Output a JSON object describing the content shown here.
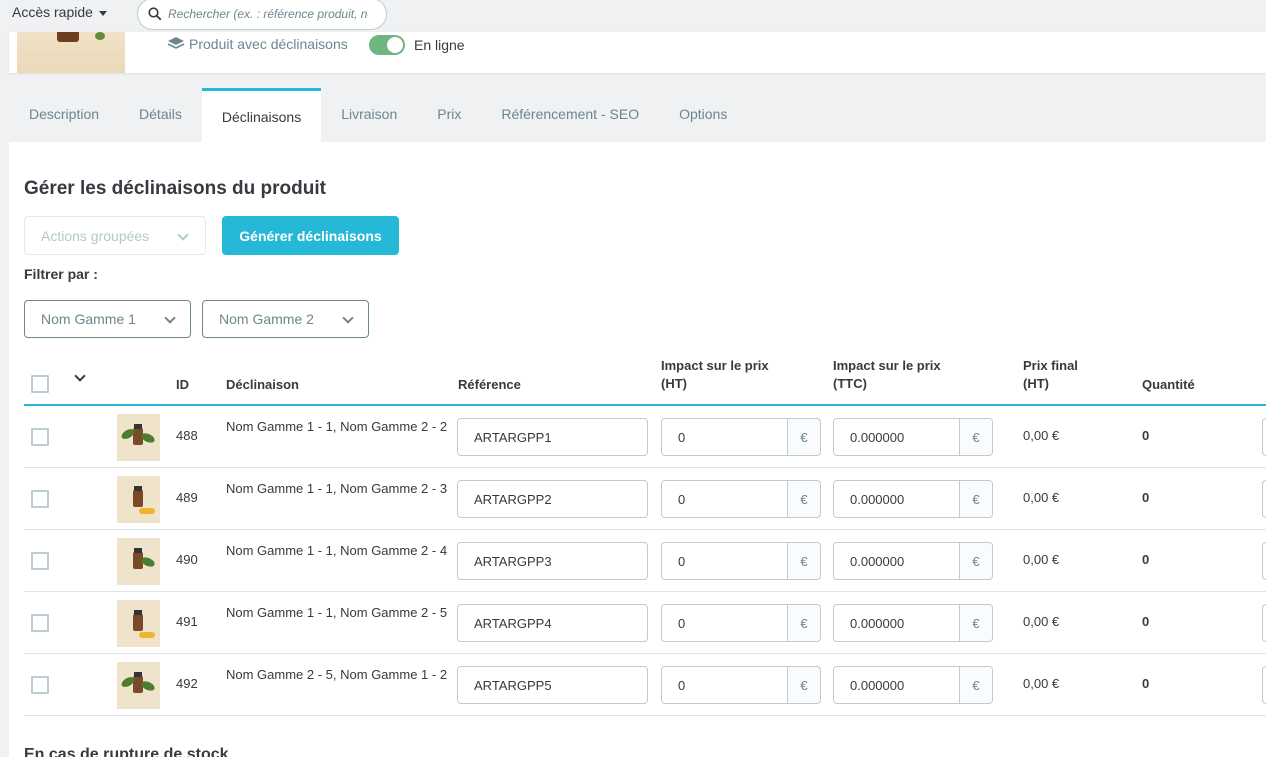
{
  "header": {
    "quick_access": "Accès rapide",
    "search_placeholder": "Rechercher (ex. : référence produit, no",
    "product_type": "Produit avec déclinaisons",
    "online_label": "En ligne",
    "online": true
  },
  "tabs": [
    {
      "label": "Description"
    },
    {
      "label": "Détails"
    },
    {
      "label": "Déclinaisons",
      "active": true
    },
    {
      "label": "Livraison"
    },
    {
      "label": "Prix"
    },
    {
      "label": "Référencement - SEO"
    },
    {
      "label": "Options"
    }
  ],
  "panel": {
    "title": "Gérer les déclinaisons du produit",
    "bulk_actions": "Actions groupées",
    "generate": "Générer déclinaisons",
    "filter_label": "Filtrer par :",
    "filters": [
      "Nom Gamme 1",
      "Nom Gamme 2"
    ],
    "footer_title": "En cas de rupture de stock"
  },
  "table": {
    "columns": {
      "id": "ID",
      "declinaison": "Déclinaison",
      "reference": "Référence",
      "impact_ht_1": "Impact sur le prix",
      "impact_ht_2": "(HT)",
      "impact_ttc_1": "Impact sur le prix",
      "impact_ttc_2": "(TTC)",
      "final_1": "Prix final",
      "final_2": "(HT)",
      "quantity": "Quantité"
    },
    "currency": "€",
    "rows": [
      {
        "id": "488",
        "name": "Nom Gamme 1 - 1, Nom Gamme 2 - 2",
        "reference": "ARTARGPP1",
        "impact_ht": "0",
        "impact_ttc": "0.000000",
        "final": "0,00 €",
        "qty": "0"
      },
      {
        "id": "489",
        "name": "Nom Gamme 1 - 1, Nom Gamme 2 - 3",
        "reference": "ARTARGPP2",
        "impact_ht": "0",
        "impact_ttc": "0.000000",
        "final": "0,00 €",
        "qty": "0"
      },
      {
        "id": "490",
        "name": "Nom Gamme 1 - 1, Nom Gamme 2 - 4",
        "reference": "ARTARGPP3",
        "impact_ht": "0",
        "impact_ttc": "0.000000",
        "final": "0,00 €",
        "qty": "0"
      },
      {
        "id": "491",
        "name": "Nom Gamme 1 - 1, Nom Gamme 2 - 5",
        "reference": "ARTARGPP4",
        "impact_ht": "0",
        "impact_ttc": "0.000000",
        "final": "0,00 €",
        "qty": "0"
      },
      {
        "id": "492",
        "name": "Nom Gamme 2 - 5, Nom Gamme 1 - 2",
        "reference": "ARTARGPP5",
        "impact_ht": "0",
        "impact_ttc": "0.000000",
        "final": "0,00 €",
        "qty": "0"
      }
    ]
  },
  "colors": {
    "accent": "#25b9d7",
    "toggle_on": "#70b580",
    "text": "#363a41",
    "muted": "#6c868e"
  }
}
